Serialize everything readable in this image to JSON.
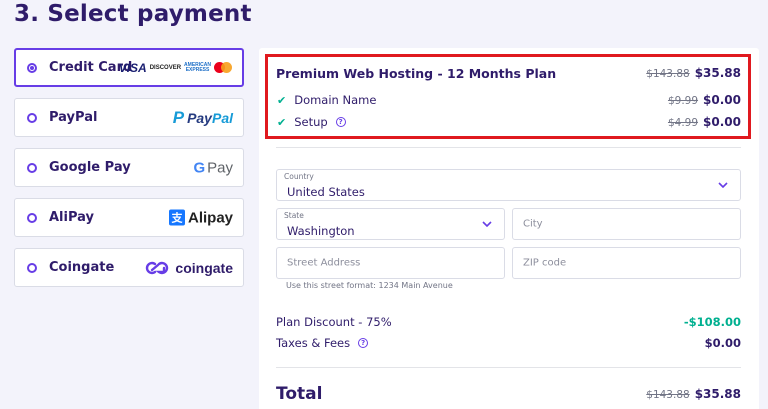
{
  "heading": "3. Select payment",
  "methods": [
    {
      "label": "Credit Card",
      "selected": true
    },
    {
      "label": "PayPal",
      "selected": false
    },
    {
      "label": "Google Pay",
      "selected": false
    },
    {
      "label": "AliPay",
      "selected": false
    },
    {
      "label": "Coingate",
      "selected": false
    }
  ],
  "logos": {
    "visa": "VISA",
    "discover": "DISCOVER",
    "amex_1": "AMERICAN",
    "amex_2": "EXPRESS",
    "paypal_mark": "P",
    "paypal_1": "Pay",
    "paypal_2": "Pal",
    "gpay_g": "G",
    "gpay_text": "Pay",
    "alipay_mark": "支",
    "alipay_text": "Alipay",
    "coingate_text": "coingate"
  },
  "summary": {
    "plan_title": "Premium Web Hosting - 12 Months Plan",
    "plan_old_price": "$143.88",
    "plan_price": "$35.88",
    "items": [
      {
        "label": "Domain Name",
        "old_price": "$9.99",
        "price": "$0.00"
      },
      {
        "label": "Setup",
        "old_price": "$4.99",
        "price": "$0.00"
      }
    ],
    "help_icon": "?"
  },
  "form": {
    "country_label": "Country",
    "country_value": "United States",
    "state_label": "State",
    "state_value": "Washington",
    "city_placeholder": "City",
    "street_placeholder": "Street Address",
    "zip_placeholder": "ZIP code",
    "street_hint": "Use this street format: 1234 Main Avenue"
  },
  "totals": {
    "discount_label": "Plan Discount - 75%",
    "discount_value": "-$108.00",
    "taxes_label": "Taxes & Fees",
    "taxes_value": "$0.00",
    "total_label": "Total",
    "total_old": "$143.88",
    "total_value": "$35.88"
  },
  "colors": {
    "accent": "#673de6",
    "heading": "#2f1c6a",
    "check": "#00b090",
    "discount": "#00b090",
    "highlight_border": "#e0191f"
  }
}
